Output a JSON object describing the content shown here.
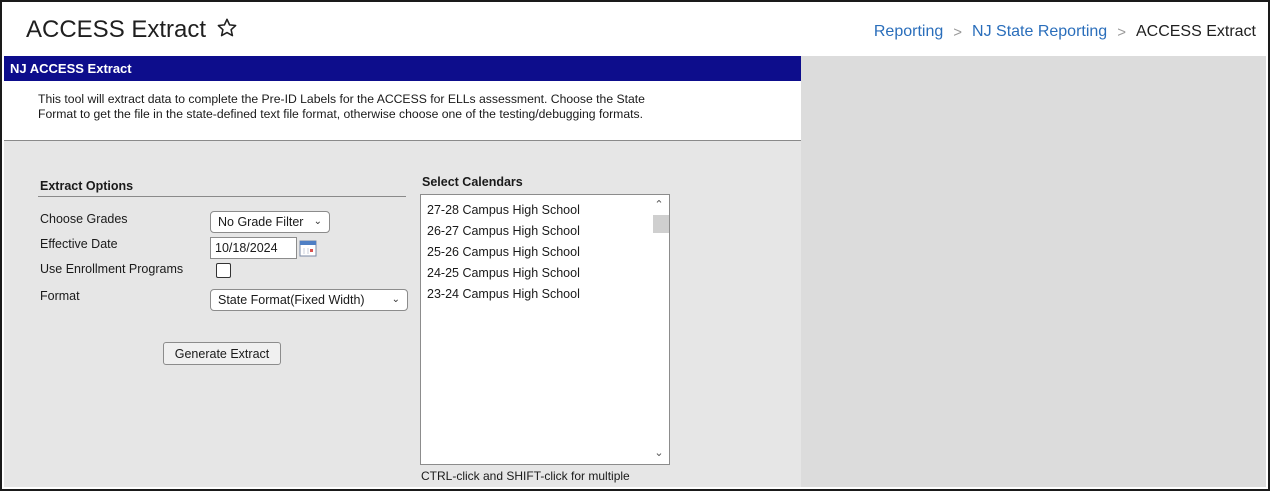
{
  "header": {
    "title": "ACCESS Extract",
    "breadcrumb": [
      "Reporting",
      "NJ State Reporting",
      "ACCESS Extract"
    ]
  },
  "panel": {
    "title": "NJ ACCESS Extract",
    "description_line1": "This tool will extract data to complete the Pre-ID Labels for the ACCESS for ELLs assessment. Choose the State",
    "description_line2": "Format to get the file in the state-defined text file format, otherwise choose one of the testing/debugging formats."
  },
  "extract_options": {
    "title": "Extract Options",
    "grades_label": "Choose Grades",
    "grades_value": "No Grade Filter",
    "date_label": "Effective Date",
    "date_value": "10/18/2024",
    "enrollment_label": "Use Enrollment Programs",
    "enrollment_checked": false,
    "format_label": "Format",
    "format_value": "State Format(Fixed Width)",
    "generate_label": "Generate Extract"
  },
  "calendars": {
    "title": "Select Calendars",
    "items": [
      "27-28 Campus High School",
      "26-27 Campus High School",
      "25-26 Campus High School",
      "24-25 Campus High School",
      "23-24 Campus High School"
    ],
    "hint": "CTRL-click and SHIFT-click for multiple"
  },
  "colors": {
    "panel_header_bg": "#0d0d8c",
    "breadcrumb_link": "#2a6ebb",
    "background": "#dcdcdc"
  },
  "icons": {
    "favorite": "star-icon",
    "calendar": "calendar-icon",
    "dropdown": "chevron-down-icon"
  }
}
